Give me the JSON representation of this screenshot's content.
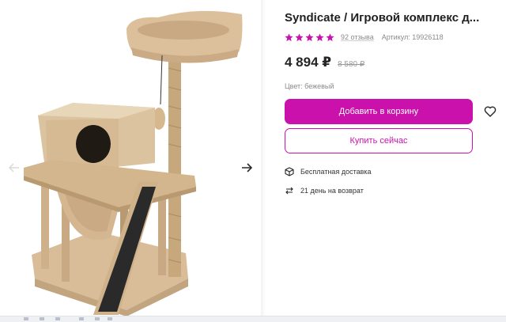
{
  "product": {
    "title": "Syndicate / Игровой комплекс д...",
    "rating_stars": 5,
    "reviews": "92 отзыва",
    "article": "Артикул: 19926118",
    "price": "4 894 ₽",
    "old_price": "8 580 ₽",
    "color": "Цвет: бежевый"
  },
  "actions": {
    "add_to_cart": "Добавить в корзину",
    "buy_now": "Купить сейчас"
  },
  "features": [
    {
      "icon": "box-icon",
      "label": "Бесплатная доставка"
    },
    {
      "icon": "return-arrows-icon",
      "label": "21 день на возврат"
    }
  ],
  "colors": {
    "accent": "#cb11ab",
    "star": "#cb11ab",
    "plush": "#d9bd98"
  }
}
